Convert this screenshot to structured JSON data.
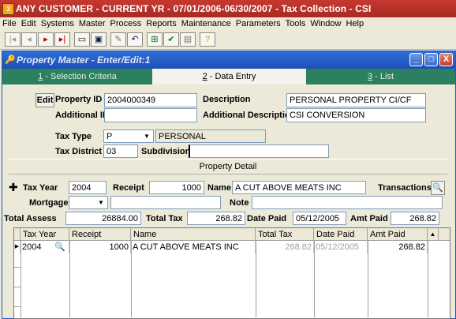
{
  "app": {
    "title": "ANY CUSTOMER - CURRENT YR - 07/01/2006-06/30/2007 - Tax Collection - CSI",
    "logo_text": "3",
    "menu": [
      "File",
      "Edit",
      "Systems",
      "Master",
      "Process",
      "Reports",
      "Maintenance",
      "Parameters",
      "Tools",
      "Window",
      "Help"
    ],
    "toolbar_icons": [
      "first-icon",
      "prev-icon",
      "next-icon",
      "last-icon",
      "new-icon",
      "save-icon",
      "delete-icon",
      "undo-icon",
      "insert-icon",
      "check-icon",
      "notes-icon",
      "help-icon"
    ]
  },
  "window": {
    "title": "Property Master - Enter/Edit:1",
    "min": "_",
    "max": "□",
    "close": "X"
  },
  "tabs": [
    {
      "key": "1",
      "label": " - Selection Criteria",
      "active": false
    },
    {
      "key": "2",
      "label": " - Data Entry",
      "active": true
    },
    {
      "key": "3",
      "label": " - List",
      "active": false
    }
  ],
  "form": {
    "edit_button": "Edit",
    "property_id_label": "Property ID",
    "property_id": "2004000349",
    "description_label": "Description",
    "description": "PERSONAL PROPERTY CI/CF",
    "additional_id_label": "Additional ID",
    "additional_id": "",
    "additional_description_label": "Additional Description",
    "additional_description": "CSI CONVERSION",
    "tax_type_label": "Tax Type",
    "tax_type": "P",
    "tax_type_name": "PERSONAL",
    "tax_district_label": "Tax District",
    "tax_district": "03",
    "subdivision_label": "Subdivision",
    "subdivision": ""
  },
  "detail": {
    "header": "Property Detail",
    "tax_year_label": "Tax Year",
    "tax_year": "2004",
    "receipt_label": "Receipt",
    "receipt": "1000",
    "name_label": "Name",
    "name": "A CUT ABOVE MEATS INC",
    "transactions_label": "Transactions",
    "mortgage_label": "Mortgage",
    "mortgage": "",
    "note_label": "Note",
    "note": "",
    "total_assess_label": "Total Assess",
    "total_assess": "26884.00",
    "total_tax_label": "Total Tax",
    "total_tax": "268.82",
    "date_paid_label": "Date Paid",
    "date_paid": "05/12/2005",
    "amt_paid_label": "Amt Paid",
    "amt_paid": "268.82"
  },
  "grid": {
    "columns": [
      "Tax Year",
      "Receipt",
      "Name",
      "Total Tax",
      "Date Paid",
      "Amt Paid"
    ],
    "rows": [
      {
        "tax_year": "2004",
        "receipt": "1000",
        "name": "A CUT ABOVE MEATS INC",
        "total_tax": "268.82",
        "date_paid": "05/12/2005",
        "amt_paid": "268.82"
      }
    ]
  }
}
